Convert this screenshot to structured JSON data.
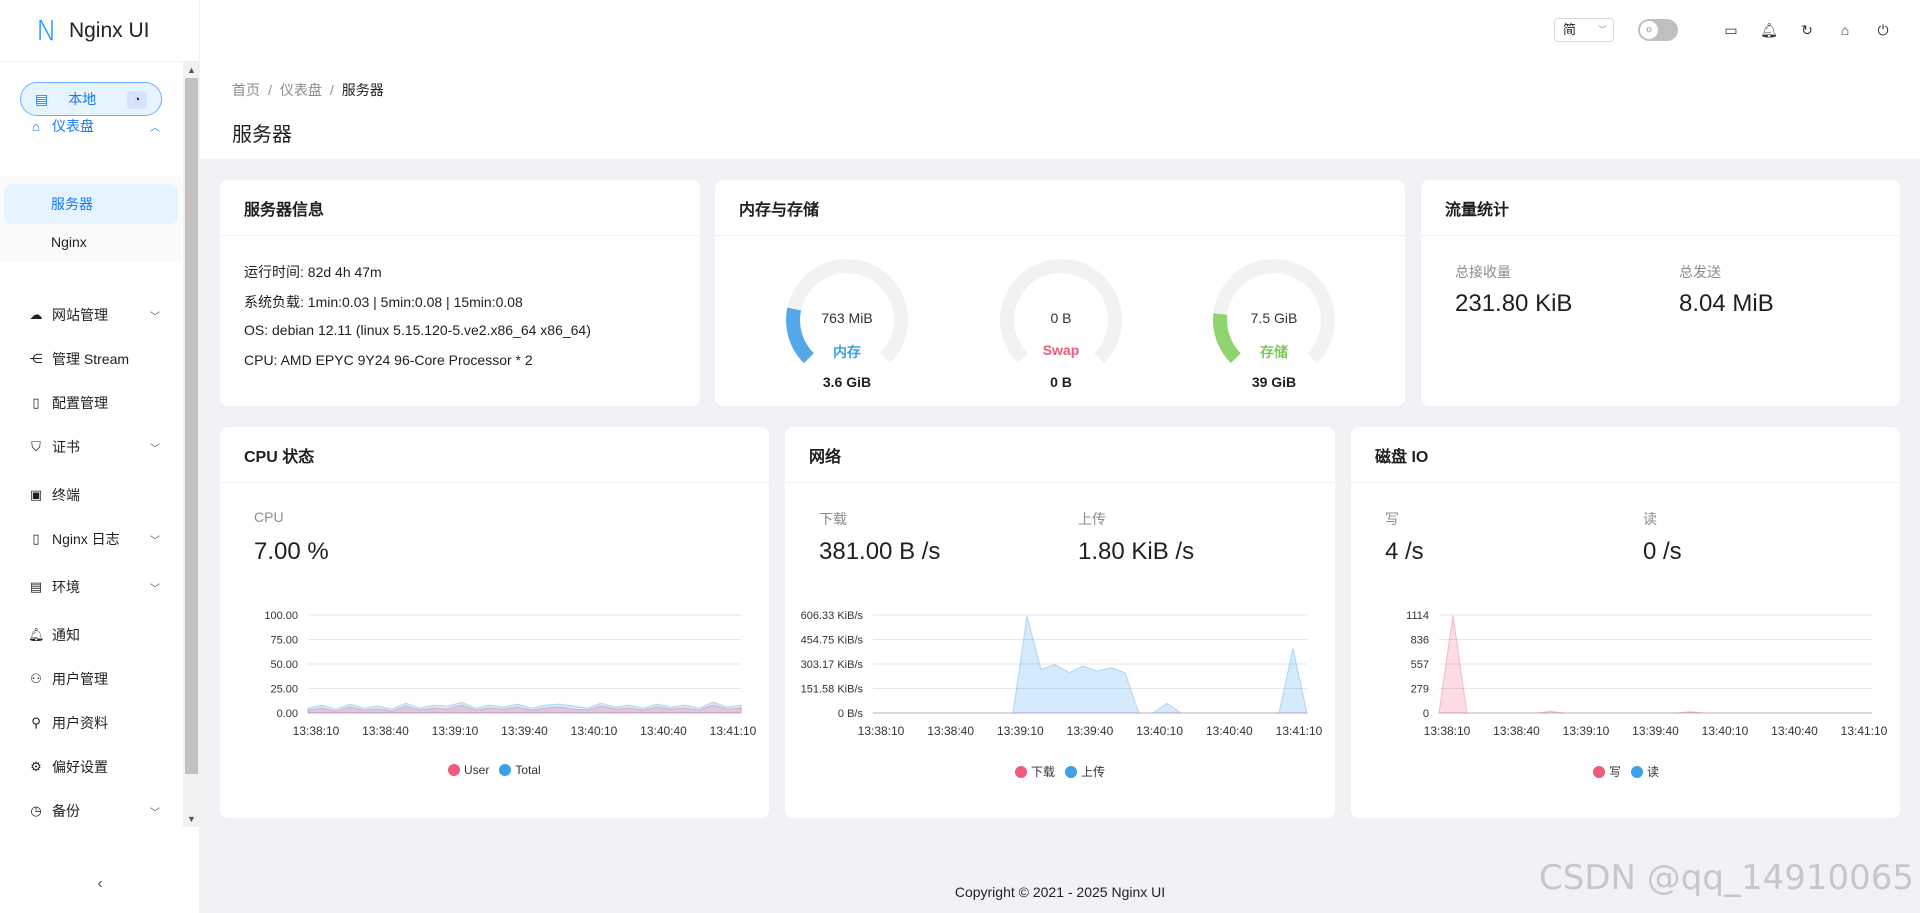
{
  "app": {
    "logo_mark": "N",
    "title": "Nginx UI"
  },
  "env": {
    "label": "本地"
  },
  "sidebar": {
    "dashboard": "仪表盘",
    "sub_server": "服务器",
    "sub_nginx": "Nginx",
    "items": [
      {
        "label": "网站管理"
      },
      {
        "label": "管理 Stream"
      },
      {
        "label": "配置管理"
      },
      {
        "label": "证书"
      },
      {
        "label": "终端"
      },
      {
        "label": "Nginx 日志"
      },
      {
        "label": "环境"
      },
      {
        "label": "通知"
      },
      {
        "label": "用户管理"
      },
      {
        "label": "用户资料"
      },
      {
        "label": "偏好设置"
      },
      {
        "label": "备份"
      }
    ]
  },
  "header": {
    "lang": "简"
  },
  "breadcrumb": {
    "home": "首页",
    "dashboard": "仪表盘",
    "current": "服务器"
  },
  "page_title": "服务器",
  "server_info": {
    "title": "服务器信息",
    "uptime": "运行时间: 82d 4h 47m",
    "load": "系统负载: 1min:0.03 | 5min:0.08 | 15min:0.08",
    "os": "OS: debian 12.11 (linux 5.15.120-5.ve2.x86_64 x86_64)",
    "cpu": "CPU: AMD EPYC 9Y24 96-Core Processor * 2"
  },
  "memory": {
    "title": "内存与存储",
    "gauges": [
      {
        "value": "763 MiB",
        "label": "内存",
        "total": "3.6 GiB",
        "fraction": 0.21,
        "color": "#52a8e8"
      },
      {
        "value": "0 B",
        "label": "Swap",
        "total": "0 B",
        "fraction": 0.0,
        "color": "#f05b7c"
      },
      {
        "value": "7.5 GiB",
        "label": "存储",
        "total": "39 GiB",
        "fraction": 0.19,
        "color": "#8fd46f"
      }
    ]
  },
  "traffic": {
    "title": "流量统计",
    "recv_label": "总接收量",
    "recv_value": "231.80 KiB",
    "sent_label": "总发送",
    "sent_value": "8.04 MiB"
  },
  "cpu": {
    "title": "CPU 状态",
    "label": "CPU",
    "value": "7.00 %",
    "legend": [
      "User",
      "Total"
    ]
  },
  "network": {
    "title": "网络",
    "down_label": "下载",
    "down_value": "381.00 B /s",
    "up_label": "上传",
    "up_value": "1.80 KiB /s",
    "legend": [
      "下载",
      "上传"
    ]
  },
  "disk": {
    "title": "磁盘 IO",
    "write_label": "写",
    "write_value": "4 /s",
    "read_label": "读",
    "read_value": "0 /s",
    "legend": [
      "写",
      "读"
    ]
  },
  "footer": "Copyright © 2021 - 2025 Nginx UI",
  "watermark": "CSDN @qq_14910065",
  "colors": {
    "accent": "#1677ff",
    "series_pink": "#f05b7c",
    "series_blue": "#3ea0e6"
  },
  "chart_data": [
    {
      "type": "area",
      "chart": "cpu",
      "x": [
        "13:38:10",
        "13:38:40",
        "13:39:10",
        "13:39:40",
        "13:40:10",
        "13:40:40",
        "13:41:10"
      ],
      "yticks": [
        "100.00",
        "75.00",
        "50.00",
        "25.00",
        "0.00"
      ],
      "ylim": [
        0,
        100
      ],
      "series": [
        {
          "name": "User",
          "color": "#f05b7c",
          "values": [
            3,
            5,
            2,
            6,
            3,
            4,
            2,
            7,
            3,
            5,
            4,
            8,
            3,
            5,
            4,
            6,
            3,
            5,
            6,
            4,
            3,
            7,
            4,
            5,
            3,
            6,
            4,
            5,
            3,
            8,
            4,
            5
          ]
        },
        {
          "name": "Total",
          "color": "#3ea0e6",
          "values": [
            5,
            8,
            4,
            9,
            5,
            7,
            4,
            10,
            5,
            8,
            7,
            11,
            5,
            8,
            6,
            9,
            5,
            8,
            9,
            7,
            5,
            10,
            6,
            8,
            5,
            9,
            6,
            8,
            5,
            11,
            6,
            8
          ]
        }
      ]
    },
    {
      "type": "area",
      "chart": "network",
      "x": [
        "13:38:10",
        "13:38:40",
        "13:39:10",
        "13:39:40",
        "13:40:10",
        "13:40:40",
        "13:41:10"
      ],
      "yticks": [
        "606.33 KiB/s",
        "454.75 KiB/s",
        "303.17 KiB/s",
        "151.58 KiB/s",
        "0 B/s"
      ],
      "ylim": [
        0,
        606.33
      ],
      "series": [
        {
          "name": "下载",
          "color": "#f05b7c",
          "values": [
            0,
            0,
            0,
            0,
            0,
            0,
            0,
            0,
            0,
            0,
            0,
            0,
            0,
            0,
            0,
            0,
            0,
            0,
            0,
            0,
            0,
            0,
            0,
            0,
            0,
            0,
            0,
            0,
            0,
            0,
            0,
            0
          ]
        },
        {
          "name": "上传",
          "color": "#3ea0e6",
          "values": [
            0,
            0,
            0,
            0,
            0,
            0,
            0,
            0,
            0,
            0,
            0,
            600,
            270,
            300,
            250,
            290,
            260,
            280,
            250,
            0,
            0,
            60,
            0,
            0,
            0,
            0,
            0,
            0,
            0,
            0,
            400,
            0
          ]
        }
      ]
    },
    {
      "type": "area",
      "chart": "disk",
      "x": [
        "13:38:10",
        "13:38:40",
        "13:39:10",
        "13:39:40",
        "13:40:10",
        "13:40:40",
        "13:41:10"
      ],
      "yticks": [
        "1114",
        "836",
        "557",
        "279",
        "0"
      ],
      "ylim": [
        0,
        1114
      ],
      "series": [
        {
          "name": "写",
          "color": "#f05b7c",
          "values": [
            0,
            1114,
            0,
            0,
            0,
            0,
            0,
            0,
            20,
            0,
            0,
            0,
            0,
            0,
            0,
            0,
            0,
            0,
            15,
            0,
            0,
            0,
            0,
            0,
            0,
            0,
            0,
            0,
            0,
            0,
            0,
            0
          ]
        },
        {
          "name": "读",
          "color": "#3ea0e6",
          "values": [
            0,
            0,
            0,
            0,
            0,
            0,
            0,
            0,
            0,
            0,
            0,
            0,
            0,
            0,
            0,
            0,
            0,
            0,
            0,
            0,
            0,
            0,
            0,
            0,
            0,
            0,
            0,
            0,
            0,
            0,
            0,
            0
          ]
        }
      ]
    }
  ]
}
